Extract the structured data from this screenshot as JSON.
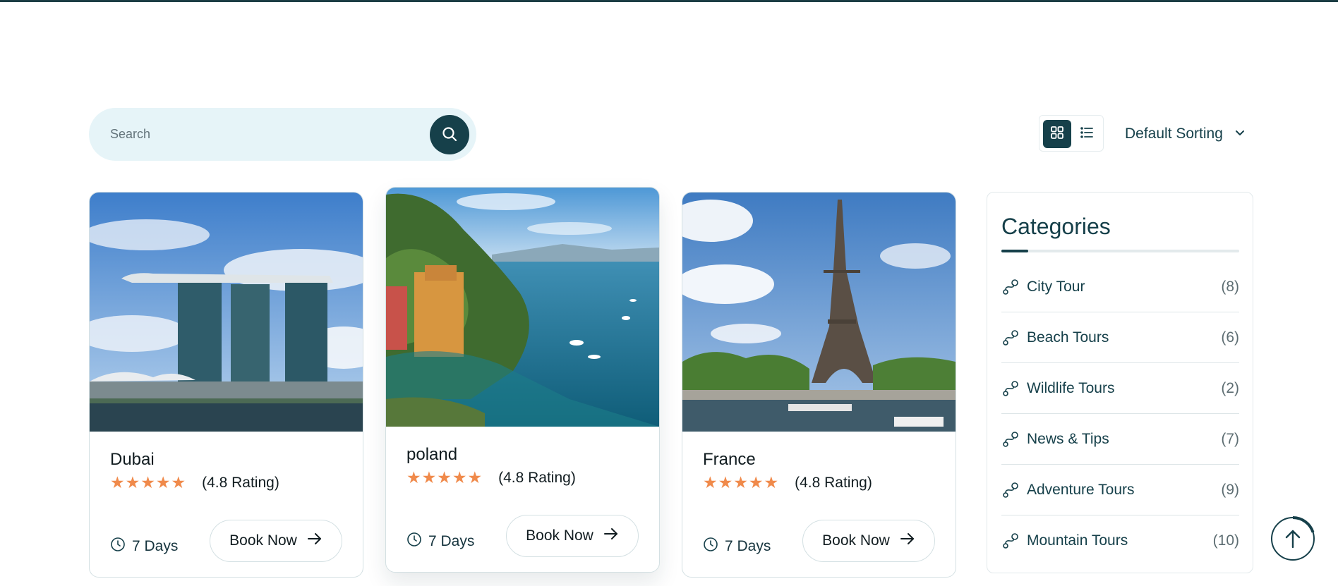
{
  "search": {
    "placeholder": "Search"
  },
  "toolbar": {
    "sort_label": "Default Sorting"
  },
  "tours": [
    {
      "title": "Dubai",
      "rating_text": "(4.8 Rating)",
      "rating": 4.8,
      "stars": "★★★★★",
      "duration": "7 Days",
      "book_label": "Book Now"
    },
    {
      "title": "poland",
      "rating_text": "(4.8 Rating)",
      "rating": 4.8,
      "stars": "★★★★★",
      "duration": "7 Days",
      "book_label": "Book Now"
    },
    {
      "title": "France",
      "rating_text": "(4.8 Rating)",
      "rating": 4.8,
      "stars": "★★★★★",
      "duration": "7 Days",
      "book_label": "Book Now"
    }
  ],
  "categories": {
    "title": "Categories",
    "items": [
      {
        "label": "City Tour",
        "count": "(8)"
      },
      {
        "label": "Beach Tours",
        "count": "(6)"
      },
      {
        "label": "Wildlife Tours",
        "count": "(2)"
      },
      {
        "label": "News & Tips",
        "count": "(7)"
      },
      {
        "label": "Adventure Tours",
        "count": "(9)"
      },
      {
        "label": "Mountain Tours",
        "count": "(10)"
      }
    ]
  },
  "scroll_progress": 0.2,
  "colors": {
    "primary": "#16404a",
    "accent_star": "#f08a4b",
    "search_bg": "#e6f4f8"
  }
}
